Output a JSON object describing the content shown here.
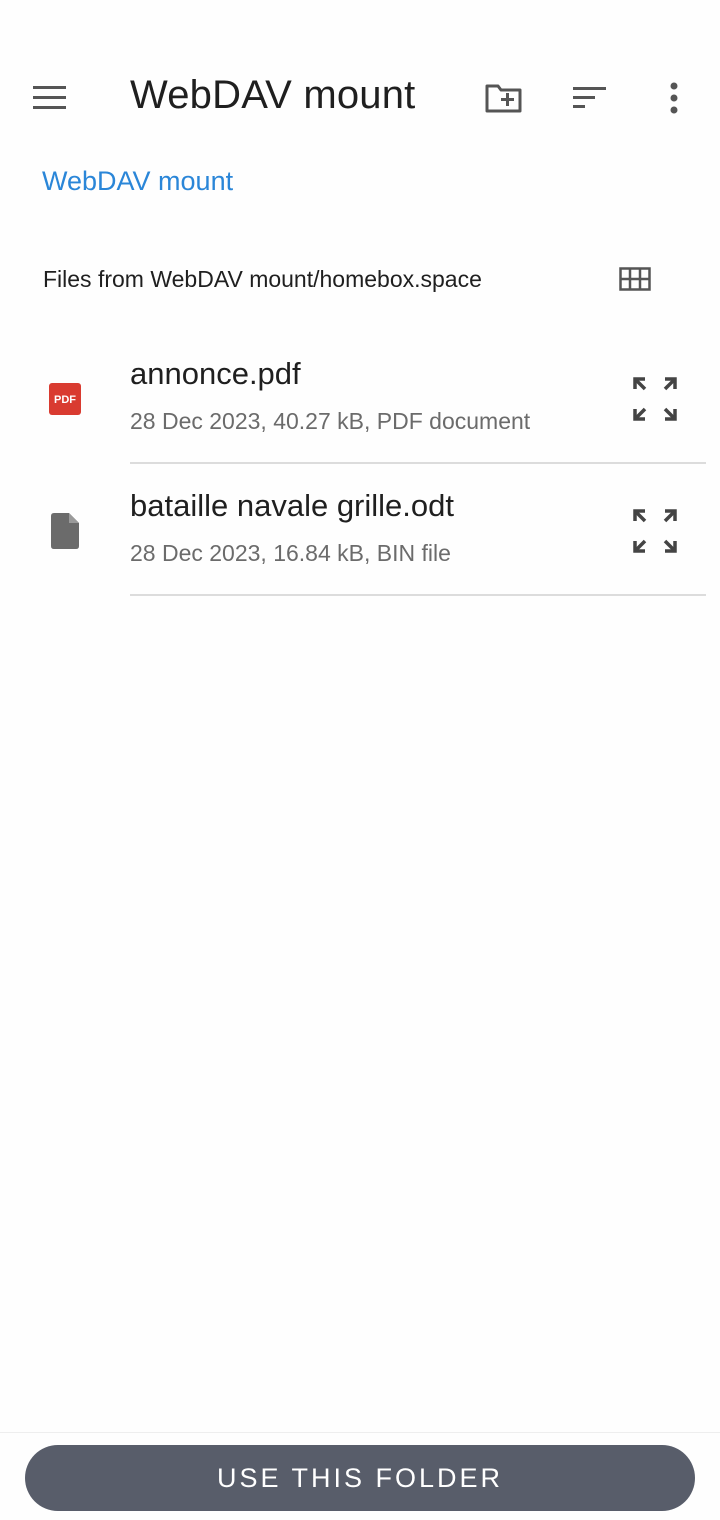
{
  "toolbar": {
    "title": "WebDAV mount",
    "menu_icon": "menu-icon",
    "new_folder_icon": "create-new-folder-icon",
    "sort_icon": "sort-icon",
    "more_icon": "more-vertical-icon"
  },
  "breadcrumb": {
    "label": "WebDAV mount",
    "color": "#2a86d8"
  },
  "section": {
    "title": "Files from WebDAV mount/homebox.space",
    "view_toggle_icon": "grid-view-icon"
  },
  "files": [
    {
      "name": "annonce.pdf",
      "meta": "28 Dec 2023, 40.27 kB, PDF document",
      "icon": "pdf-file-icon",
      "icon_text": "PDF",
      "action_icon": "expand-preview-icon"
    },
    {
      "name": "bataille navale grille.odt",
      "meta": "28 Dec 2023, 16.84 kB, BIN file",
      "icon": "generic-file-icon",
      "action_icon": "expand-preview-icon"
    }
  ],
  "bottom": {
    "button_label": "USE THIS FOLDER",
    "button_color": "#585d6a"
  }
}
